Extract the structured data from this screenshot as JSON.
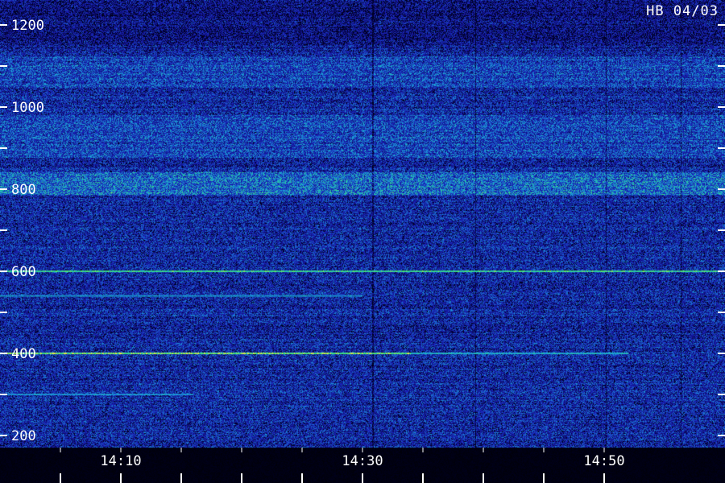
{
  "corner_label": "HB 04/03",
  "chart_data": {
    "type": "heatmap",
    "title": "",
    "xlabel": "",
    "ylabel": "",
    "x_range": [
      "14:05",
      "14:54"
    ],
    "y_range": [
      170,
      1260
    ],
    "y_ticks": [
      {
        "value": 200,
        "label": "200"
      },
      {
        "value": 300,
        "label": ""
      },
      {
        "value": 400,
        "label": "400"
      },
      {
        "value": 500,
        "label": ""
      },
      {
        "value": 600,
        "label": "600"
      },
      {
        "value": 700,
        "label": ""
      },
      {
        "value": 800,
        "label": "800"
      },
      {
        "value": 900,
        "label": ""
      },
      {
        "value": 1000,
        "label": "1000"
      },
      {
        "value": 1100,
        "label": ""
      },
      {
        "value": 1200,
        "label": "1200"
      }
    ],
    "x_major_ticks": [
      {
        "minute": 10,
        "label": "14:10"
      },
      {
        "minute": 30,
        "label": "14:30"
      },
      {
        "minute": 50,
        "label": "14:50"
      }
    ],
    "x_minor_tick_minutes": [
      5,
      10,
      15,
      20,
      25,
      30,
      35,
      40,
      45,
      50
    ],
    "lines": [
      {
        "y": 400,
        "x_start": "14:05",
        "x_end": "14:34",
        "strength": 0.85
      },
      {
        "y": 400,
        "x_start": "14:34",
        "x_end": "14:52",
        "strength": 0.45
      },
      {
        "y": 600,
        "x_start": "14:05",
        "x_end": "14:54",
        "strength": 0.7
      },
      {
        "y": 300,
        "x_start": "14:05",
        "x_end": "14:16",
        "strength": 0.3
      },
      {
        "y": 540,
        "x_start": "14:05",
        "x_end": "14:30",
        "strength": 0.3
      }
    ],
    "bands": [
      {
        "y_low": 790,
        "y_high": 840,
        "strength": 0.55
      },
      {
        "y_low": 880,
        "y_high": 980,
        "strength": 0.25
      },
      {
        "y_low": 1050,
        "y_high": 1150,
        "strength": 0.22
      }
    ],
    "colors": {
      "background": "#000000",
      "low": "#1a1fb8",
      "mid": "#1aa0d8",
      "high": "#39e07a",
      "peak": "#e8e840",
      "axis": "#ffffff"
    }
  }
}
